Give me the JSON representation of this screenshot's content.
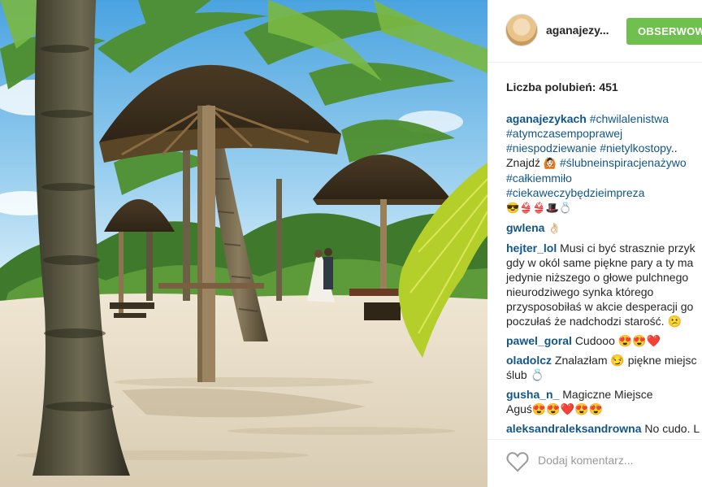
{
  "header": {
    "username": "aganajezy...",
    "follow_label": "OBSERWOW"
  },
  "likes_text": "Liczba polubień: 451",
  "caption": {
    "user": "aganajezykach",
    "line1_tag": "#chwilalenistwa",
    "line2_tag": "#atymczasempoprawej",
    "line3_tag_a": "#niespodziewanie",
    "line3_tag_b": "#nietylkostopy",
    "line3_suffix": "..",
    "line4_text": "Znajdź",
    "line4_emoji": "🙆🏻",
    "line4_tag": "#ślubneinspiracjenażywo",
    "line5_tag": "#całkiemmiło",
    "line6_tag": "#ciekaweczybędzieimpreza",
    "line7_emoji": "😎👙👙🎩💍"
  },
  "comments": [
    {
      "user": "gwlena",
      "text": "👌🏻"
    },
    {
      "user": "hejter_lol",
      "lines": [
        "Musi ci być strasznie przyk",
        "gdy w okól same piękne pary a ty ma",
        "jedynie niższego o głowe pulchnego",
        "nieurodziwego synka którego",
        "przysposobiłaś w akcie desperacji go",
        "poczułaś że nadchodzi starość. 😕"
      ]
    },
    {
      "user": "pawel_goral",
      "text": "Cudooo 😍😍❤️"
    },
    {
      "user": "oladolcz",
      "text": "Znalazłam 😏 piękne miejsc",
      "text2": "ślub 💍"
    },
    {
      "user": "gusha_n_",
      "text": "Magiczne Miejsce",
      "text2": "Aguś😍😍❤️😍😍"
    },
    {
      "user": "aleksandraleksandrowna",
      "text": "No cudo. L"
    }
  ],
  "add_comment": {
    "placeholder": "Dodaj komentarz..."
  },
  "colors": {
    "link": "#125688",
    "follow_green": "#70c050",
    "text": "#262626",
    "muted": "#999999"
  },
  "icons": {
    "like": "heart-outline-icon"
  }
}
